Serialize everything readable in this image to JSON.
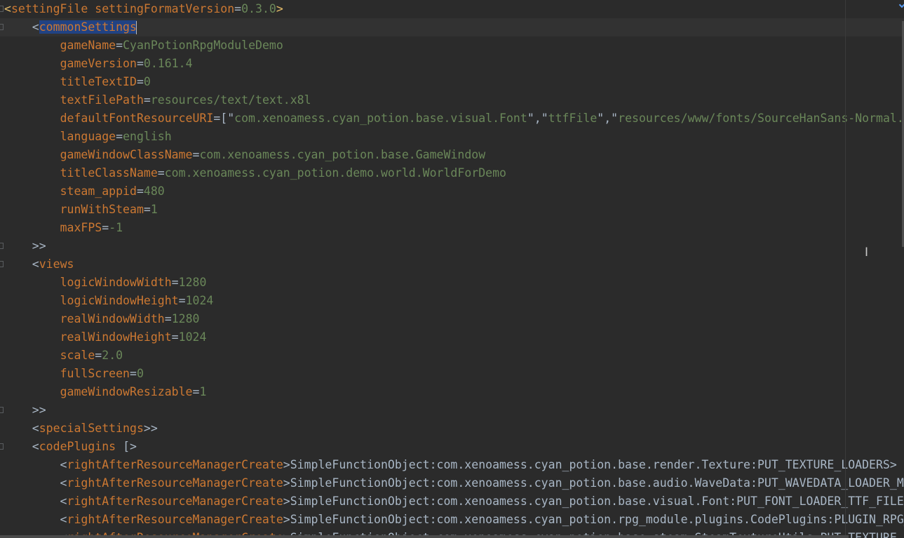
{
  "editor": {
    "lines": [
      {
        "parts": [
          {
            "k": "br",
            "t": "<"
          },
          {
            "k": "key",
            "t": "settingFile settingFormatVersion"
          },
          {
            "k": "punc",
            "t": "="
          },
          {
            "k": "val",
            "t": "0.3.0"
          },
          {
            "k": "br",
            "t": ">"
          }
        ]
      },
      {
        "parts": [
          {
            "k": "punc",
            "t": "    <"
          },
          {
            "k": "sel",
            "t": "commonSettings"
          },
          {
            "k": "caret",
            "t": ""
          }
        ],
        "current": true
      },
      {
        "parts": [
          {
            "k": "punc",
            "t": "        "
          },
          {
            "k": "key",
            "t": "gameName"
          },
          {
            "k": "punc",
            "t": "="
          },
          {
            "k": "val",
            "t": "CyanPotionRpgModuleDemo"
          }
        ]
      },
      {
        "parts": [
          {
            "k": "punc",
            "t": "        "
          },
          {
            "k": "key",
            "t": "gameVersion"
          },
          {
            "k": "punc",
            "t": "="
          },
          {
            "k": "val",
            "t": "0.161.4"
          }
        ]
      },
      {
        "parts": [
          {
            "k": "punc",
            "t": "        "
          },
          {
            "k": "key",
            "t": "titleTextID"
          },
          {
            "k": "punc",
            "t": "="
          },
          {
            "k": "val",
            "t": "0"
          }
        ]
      },
      {
        "parts": [
          {
            "k": "punc",
            "t": "        "
          },
          {
            "k": "key",
            "t": "textFilePath"
          },
          {
            "k": "punc",
            "t": "="
          },
          {
            "k": "val",
            "t": "resources/text/text.x8l"
          }
        ]
      },
      {
        "parts": [
          {
            "k": "punc",
            "t": "        "
          },
          {
            "k": "key",
            "t": "defaultFontResourceURI"
          },
          {
            "k": "punc",
            "t": "=[\""
          },
          {
            "k": "val",
            "t": "com.xenoamess.cyan_potion.base.visual.Font"
          },
          {
            "k": "punc",
            "t": "\",\""
          },
          {
            "k": "val",
            "t": "ttfFile"
          },
          {
            "k": "punc",
            "t": "\",\""
          },
          {
            "k": "val",
            "t": "resources/www/fonts/SourceHanSans-Normal.ttc"
          }
        ]
      },
      {
        "parts": [
          {
            "k": "punc",
            "t": "        "
          },
          {
            "k": "key",
            "t": "language"
          },
          {
            "k": "punc",
            "t": "="
          },
          {
            "k": "val",
            "t": "english"
          }
        ]
      },
      {
        "parts": [
          {
            "k": "punc",
            "t": "        "
          },
          {
            "k": "key",
            "t": "gameWindowClassName"
          },
          {
            "k": "punc",
            "t": "="
          },
          {
            "k": "val",
            "t": "com.xenoamess.cyan_potion.base.GameWindow"
          }
        ]
      },
      {
        "parts": [
          {
            "k": "punc",
            "t": "        "
          },
          {
            "k": "key",
            "t": "titleClassName"
          },
          {
            "k": "punc",
            "t": "="
          },
          {
            "k": "val",
            "t": "com.xenoamess.cyan_potion.demo.world.WorldForDemo"
          }
        ]
      },
      {
        "parts": [
          {
            "k": "punc",
            "t": "        "
          },
          {
            "k": "key",
            "t": "steam_appid"
          },
          {
            "k": "punc",
            "t": "="
          },
          {
            "k": "val",
            "t": "480"
          }
        ]
      },
      {
        "parts": [
          {
            "k": "punc",
            "t": "        "
          },
          {
            "k": "key",
            "t": "runWithSteam"
          },
          {
            "k": "punc",
            "t": "="
          },
          {
            "k": "val",
            "t": "1"
          }
        ]
      },
      {
        "parts": [
          {
            "k": "punc",
            "t": "        "
          },
          {
            "k": "key",
            "t": "maxFPS"
          },
          {
            "k": "punc",
            "t": "="
          },
          {
            "k": "val",
            "t": "-1"
          }
        ]
      },
      {
        "parts": [
          {
            "k": "punc",
            "t": "    >>"
          }
        ]
      },
      {
        "parts": [
          {
            "k": "punc",
            "t": "    <"
          },
          {
            "k": "tag",
            "t": "views"
          }
        ]
      },
      {
        "parts": [
          {
            "k": "punc",
            "t": "        "
          },
          {
            "k": "key",
            "t": "logicWindowWidth"
          },
          {
            "k": "punc",
            "t": "="
          },
          {
            "k": "val",
            "t": "1280"
          }
        ]
      },
      {
        "parts": [
          {
            "k": "punc",
            "t": "        "
          },
          {
            "k": "key",
            "t": "logicWindowHeight"
          },
          {
            "k": "punc",
            "t": "="
          },
          {
            "k": "val",
            "t": "1024"
          }
        ]
      },
      {
        "parts": [
          {
            "k": "punc",
            "t": "        "
          },
          {
            "k": "key",
            "t": "realWindowWidth"
          },
          {
            "k": "punc",
            "t": "="
          },
          {
            "k": "val",
            "t": "1280"
          }
        ]
      },
      {
        "parts": [
          {
            "k": "punc",
            "t": "        "
          },
          {
            "k": "key",
            "t": "realWindowHeight"
          },
          {
            "k": "punc",
            "t": "="
          },
          {
            "k": "val",
            "t": "1024"
          }
        ]
      },
      {
        "parts": [
          {
            "k": "punc",
            "t": "        "
          },
          {
            "k": "key",
            "t": "scale"
          },
          {
            "k": "punc",
            "t": "="
          },
          {
            "k": "val",
            "t": "2.0"
          }
        ]
      },
      {
        "parts": [
          {
            "k": "punc",
            "t": "        "
          },
          {
            "k": "key",
            "t": "fullScreen"
          },
          {
            "k": "punc",
            "t": "="
          },
          {
            "k": "val",
            "t": "0"
          }
        ]
      },
      {
        "parts": [
          {
            "k": "punc",
            "t": "        "
          },
          {
            "k": "key",
            "t": "gameWindowResizable"
          },
          {
            "k": "punc",
            "t": "="
          },
          {
            "k": "val",
            "t": "1"
          }
        ]
      },
      {
        "parts": [
          {
            "k": "punc",
            "t": "    >>"
          }
        ]
      },
      {
        "parts": [
          {
            "k": "punc",
            "t": "    <"
          },
          {
            "k": "tag",
            "t": "specialSettings"
          },
          {
            "k": "punc",
            "t": ">>"
          }
        ]
      },
      {
        "parts": [
          {
            "k": "punc",
            "t": "    <"
          },
          {
            "k": "tag",
            "t": "codePlugins"
          },
          {
            "k": "punc",
            "t": " [>"
          }
        ]
      },
      {
        "parts": [
          {
            "k": "punc",
            "t": "        <"
          },
          {
            "k": "tag",
            "t": "rightAfterResourceManagerCreate"
          },
          {
            "k": "punc",
            "t": ">SimpleFunctionObject:com.xenoamess.cyan_potion.base.render.Texture:PUT_TEXTURE_LOADERS>"
          }
        ]
      },
      {
        "parts": [
          {
            "k": "punc",
            "t": "        <"
          },
          {
            "k": "tag",
            "t": "rightAfterResourceManagerCreate"
          },
          {
            "k": "punc",
            "t": ">SimpleFunctionObject:com.xenoamess.cyan_potion.base.audio.WaveData:PUT_WAVEDATA_LOADER_MUSIC>"
          }
        ]
      },
      {
        "parts": [
          {
            "k": "punc",
            "t": "        <"
          },
          {
            "k": "tag",
            "t": "rightAfterResourceManagerCreate"
          },
          {
            "k": "punc",
            "t": ">SimpleFunctionObject:com.xenoamess.cyan_potion.base.visual.Font:PUT_FONT_LOADER_TTF_FILE>"
          }
        ]
      },
      {
        "parts": [
          {
            "k": "punc",
            "t": "        <"
          },
          {
            "k": "tag",
            "t": "rightAfterResourceManagerCreate"
          },
          {
            "k": "punc",
            "t": ">SimpleFunctionObject:com.xenoamess.cyan_potion.rpg_module.plugins.CodePlugins:PLUGIN_RPG_MODULE>"
          }
        ]
      },
      {
        "parts": [
          {
            "k": "punc",
            "t": "        <"
          },
          {
            "k": "tag",
            "t": "rightAfterResourceManagerCreate"
          },
          {
            "k": "punc",
            "t": ">SimpleFunctionObject:com.xenoamess.cyan_potion.base.steam.SteamTextureUtils:PUT_TEXTURE_LOADER_STEAM>"
          }
        ]
      }
    ],
    "fold_lines": [
      0,
      1,
      13,
      14,
      22,
      24
    ],
    "colors": {
      "background": "#2b2b2b",
      "current_line": "#323232",
      "selection": "#214283",
      "key": "#cc7832",
      "value": "#6a8759",
      "punctuation": "#a9b7c6"
    },
    "mouse_cursor_icon": "text-cursor-icon"
  }
}
